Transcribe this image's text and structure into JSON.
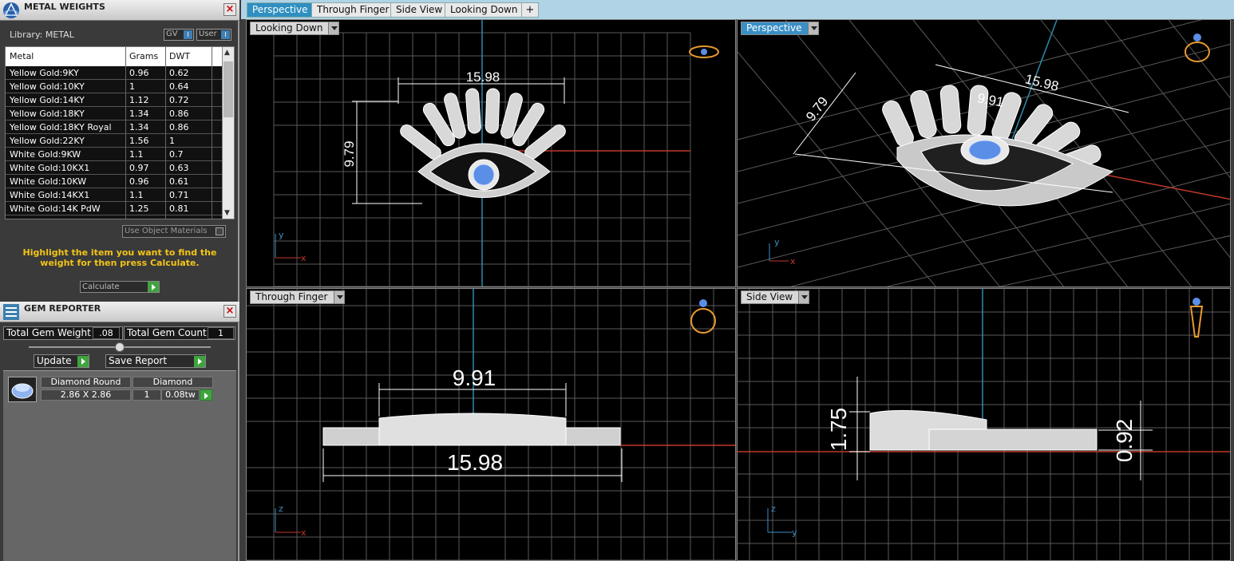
{
  "metal_weights": {
    "title": "METAL WEIGHTS",
    "library_label": "Library: METAL",
    "toggle_gv": "GV",
    "toggle_user": "User",
    "columns": [
      "Metal",
      "Grams",
      "DWT"
    ],
    "rows": [
      [
        "Yellow Gold:9KY",
        "0.96",
        "0.62"
      ],
      [
        "Yellow Gold:10KY",
        "1",
        "0.64"
      ],
      [
        "Yellow Gold:14KY",
        "1.12",
        "0.72"
      ],
      [
        "Yellow Gold:18KY",
        "1.34",
        "0.86"
      ],
      [
        "Yellow Gold:18KY Royal",
        "1.34",
        "0.86"
      ],
      [
        "Yellow Gold:22KY",
        "1.56",
        "1"
      ],
      [
        "White Gold:9KW",
        "1.1",
        "0.7"
      ],
      [
        "White Gold:10KX1",
        "0.97",
        "0.63"
      ],
      [
        "White Gold:10KW",
        "0.96",
        "0.61"
      ],
      [
        "White Gold:14KX1",
        "1.1",
        "0.71"
      ],
      [
        "White Gold:14K PdW",
        "1.25",
        "0.81"
      ]
    ],
    "use_object_materials": "Use Object Materials",
    "hint": "Highlight the item you want to find the weight for then press Calculate.",
    "calculate": "Calculate"
  },
  "gem_reporter": {
    "title": "GEM REPORTER",
    "total_gem_weight_label": "Total Gem Weight",
    "total_gem_weight": ".08",
    "total_gem_count_label": "Total Gem Count",
    "total_gem_count": "1",
    "update": "Update",
    "save_report": "Save Report",
    "gem": {
      "shape": "Diamond Round",
      "type": "Diamond",
      "size": "2.86 X 2.86",
      "count": "1",
      "weight": "0.08tw"
    }
  },
  "tabs": [
    "Perspective",
    "Through Finger",
    "Side View",
    "Looking Down",
    "+"
  ],
  "viewports": {
    "top_left": {
      "label": "Looking Down",
      "dim_width": "15.98",
      "dim_height": "9.79",
      "axis_v": "y",
      "axis_h": "x"
    },
    "top_right": {
      "label": "Perspective",
      "dim_width": "15.98",
      "dim_height": "9.79",
      "dim_inner": "9.91",
      "axis_v": "y",
      "axis_h": "x"
    },
    "bottom_left": {
      "label": "Through Finger",
      "dim_top": "9.91",
      "dim_bottom": "15.98",
      "axis_v": "z",
      "axis_h": "x"
    },
    "bottom_right": {
      "label": "Side View",
      "dim_left": "1.75",
      "dim_right": "0.92",
      "axis_v": "z",
      "axis_h": "y"
    }
  },
  "colors": {
    "accent": "#2f8fc0",
    "hint": "#f2c417",
    "grid": "#5a5a5a",
    "axis_red": "#c0392b",
    "axis_blue": "#2e8bb0",
    "gem": "#5b8ee6"
  }
}
